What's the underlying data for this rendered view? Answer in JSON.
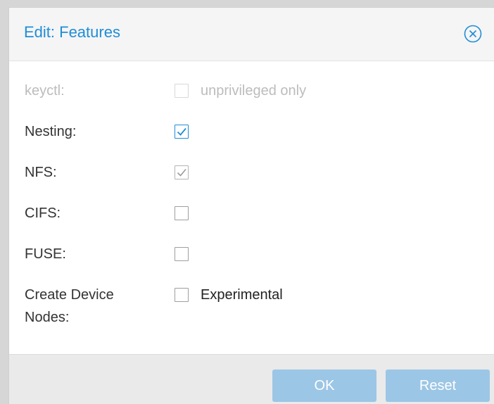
{
  "dialog": {
    "title": "Edit: Features",
    "close_icon": "close-circle-icon"
  },
  "fields": [
    {
      "label": "keyctl:",
      "checked": false,
      "disabled": true,
      "box_label": "unprivileged only"
    },
    {
      "label": "Nesting:",
      "checked": true,
      "disabled": false,
      "box_label": ""
    },
    {
      "label": "NFS:",
      "checked": true,
      "disabled": false,
      "box_label": ""
    },
    {
      "label": "CIFS:",
      "checked": false,
      "disabled": false,
      "box_label": ""
    },
    {
      "label": "FUSE:",
      "checked": false,
      "disabled": false,
      "box_label": ""
    },
    {
      "label_line1": "Create Device",
      "label_line2": "Nodes:",
      "checked": false,
      "disabled": false,
      "box_label": "Experimental"
    }
  ],
  "buttons": {
    "ok": "OK",
    "reset": "Reset"
  },
  "colors": {
    "accent": "#1f8dd6",
    "button_disabled": "#9cc6e6",
    "check_active": "#1f8dd6",
    "check_muted": "#9a9a9a"
  }
}
